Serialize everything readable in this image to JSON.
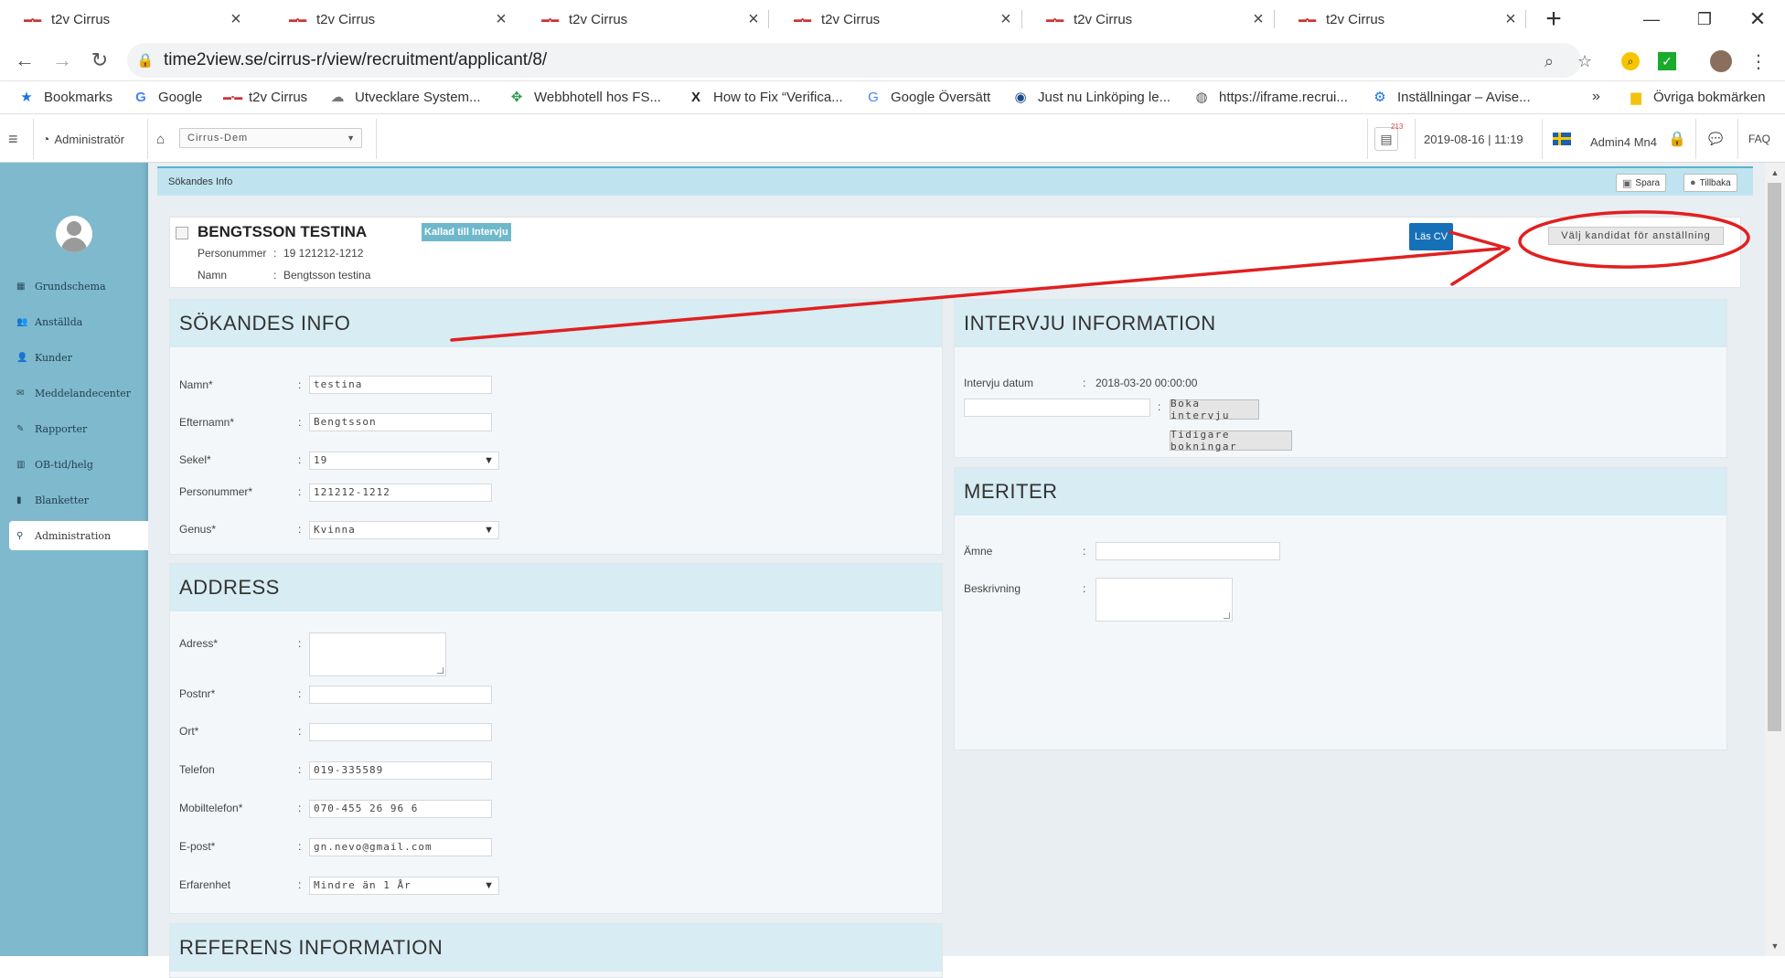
{
  "browser": {
    "tabs": [
      {
        "title": "t2v Cirrus"
      },
      {
        "title": "t2v Cirrus"
      },
      {
        "title": "t2v Cirrus"
      },
      {
        "title": "t2v Cirrus"
      },
      {
        "title": "t2v Cirrus"
      },
      {
        "title": "t2v Cirrus"
      }
    ],
    "active_tab": 1,
    "url": "time2view.se/cirrus-r/view/recruitment/applicant/8/",
    "bookmarks": [
      {
        "label": "Bookmarks",
        "icon": "star-icon"
      },
      {
        "label": "Google",
        "icon": "google-icon"
      },
      {
        "label": "t2v Cirrus",
        "icon": "t2v-icon"
      },
      {
        "label": "Utvecklare System...",
        "icon": "cloud-icon"
      },
      {
        "label": "Webbhotell hos FS...",
        "icon": "puzzle-icon"
      },
      {
        "label": "How to Fix “Verifica...",
        "icon": "x-icon"
      },
      {
        "label": "Google Översätt",
        "icon": "translate-icon"
      },
      {
        "label": "Just nu Linköping le...",
        "icon": "site-icon"
      },
      {
        "label": "https://iframe.recrui...",
        "icon": "globe-icon"
      },
      {
        "label": "Inställningar – Avise...",
        "icon": "gear-icon"
      }
    ],
    "bookmarks_more": "»",
    "other_bookmarks": "Övriga bokmärken"
  },
  "header": {
    "role": "Administratör",
    "org_select": "Cirrus-Dem",
    "notif_count": "213",
    "datetime": "2019-08-16 | 11:19",
    "user": "Admin4 Mn4",
    "faq": "FAQ"
  },
  "sidebar": {
    "items": [
      {
        "label": "Grundschema",
        "icon": "calendar-icon"
      },
      {
        "label": "Anställda",
        "icon": "users-icon"
      },
      {
        "label": "Kunder",
        "icon": "user-icon"
      },
      {
        "label": "Meddelandecenter",
        "icon": "envelope-icon"
      },
      {
        "label": "Rapporter",
        "icon": "pencil-icon"
      },
      {
        "label": "OB-tid/helg",
        "icon": "chart-icon"
      },
      {
        "label": "Blanketter",
        "icon": "file-icon"
      },
      {
        "label": "Administration",
        "icon": "key-icon"
      }
    ],
    "active": 7
  },
  "page": {
    "breadcrumb": "Sökandes Info",
    "save_label": "Spara",
    "back_label": "Tillbaka"
  },
  "candidate": {
    "name": "BENGTSSON TESTINA",
    "status_badge": "Kallad till Intervju",
    "personnummer_label": "Personummer",
    "personnummer_value": "19 121212-1212",
    "namn_label": "Namn",
    "namn_value": "Bengtsson testina",
    "cv_button": "Läs CV",
    "select_button": "Välj kandidat för anställning"
  },
  "applicant_info": {
    "heading": "SÖKANDES INFO",
    "fields": {
      "namn": {
        "label": "Namn*",
        "value": "testina"
      },
      "efternamn": {
        "label": "Efternamn*",
        "value": "Bengtsson"
      },
      "sekel": {
        "label": "Sekel*",
        "value": "19"
      },
      "personnummer": {
        "label": "Personummer*",
        "value": "121212-1212"
      },
      "genus": {
        "label": "Genus*",
        "value": "Kvinna"
      }
    }
  },
  "address": {
    "heading": "ADDRESS",
    "fields": {
      "adress": {
        "label": "Adress*",
        "value": ""
      },
      "postnr": {
        "label": "Postnr*",
        "value": ""
      },
      "ort": {
        "label": "Ort*",
        "value": ""
      },
      "telefon": {
        "label": "Telefon",
        "value": "019-335589"
      },
      "mobil": {
        "label": "Mobiltelefon*",
        "value": "070-455 26 96 6"
      },
      "epost": {
        "label": "E-post*",
        "value": "gn.nevo@gmail.com"
      },
      "erfarenhet": {
        "label": "Erfarenhet",
        "value": "Mindre än 1 År"
      }
    }
  },
  "reference": {
    "heading": "REFERENS INFORMATION"
  },
  "interview": {
    "heading": "INTERVJU INFORMATION",
    "date_label": "Intervju datum",
    "date_value": "2018-03-20 00:00:00",
    "date_input": "",
    "book_button": "Boka intervju",
    "previous_button": "Tidigare bokningar"
  },
  "merits": {
    "heading": "MERITER",
    "amne_label": "Ämne",
    "amne_value": "",
    "beskrivning_label": "Beskrivning",
    "beskrivning_value": ""
  },
  "colors": {
    "sidebar": "#7fb9cd",
    "panel_header": "#d7ecf3",
    "badge": "#6fb8cc",
    "cv_button": "#1670b8",
    "annotation": "#e02020"
  }
}
